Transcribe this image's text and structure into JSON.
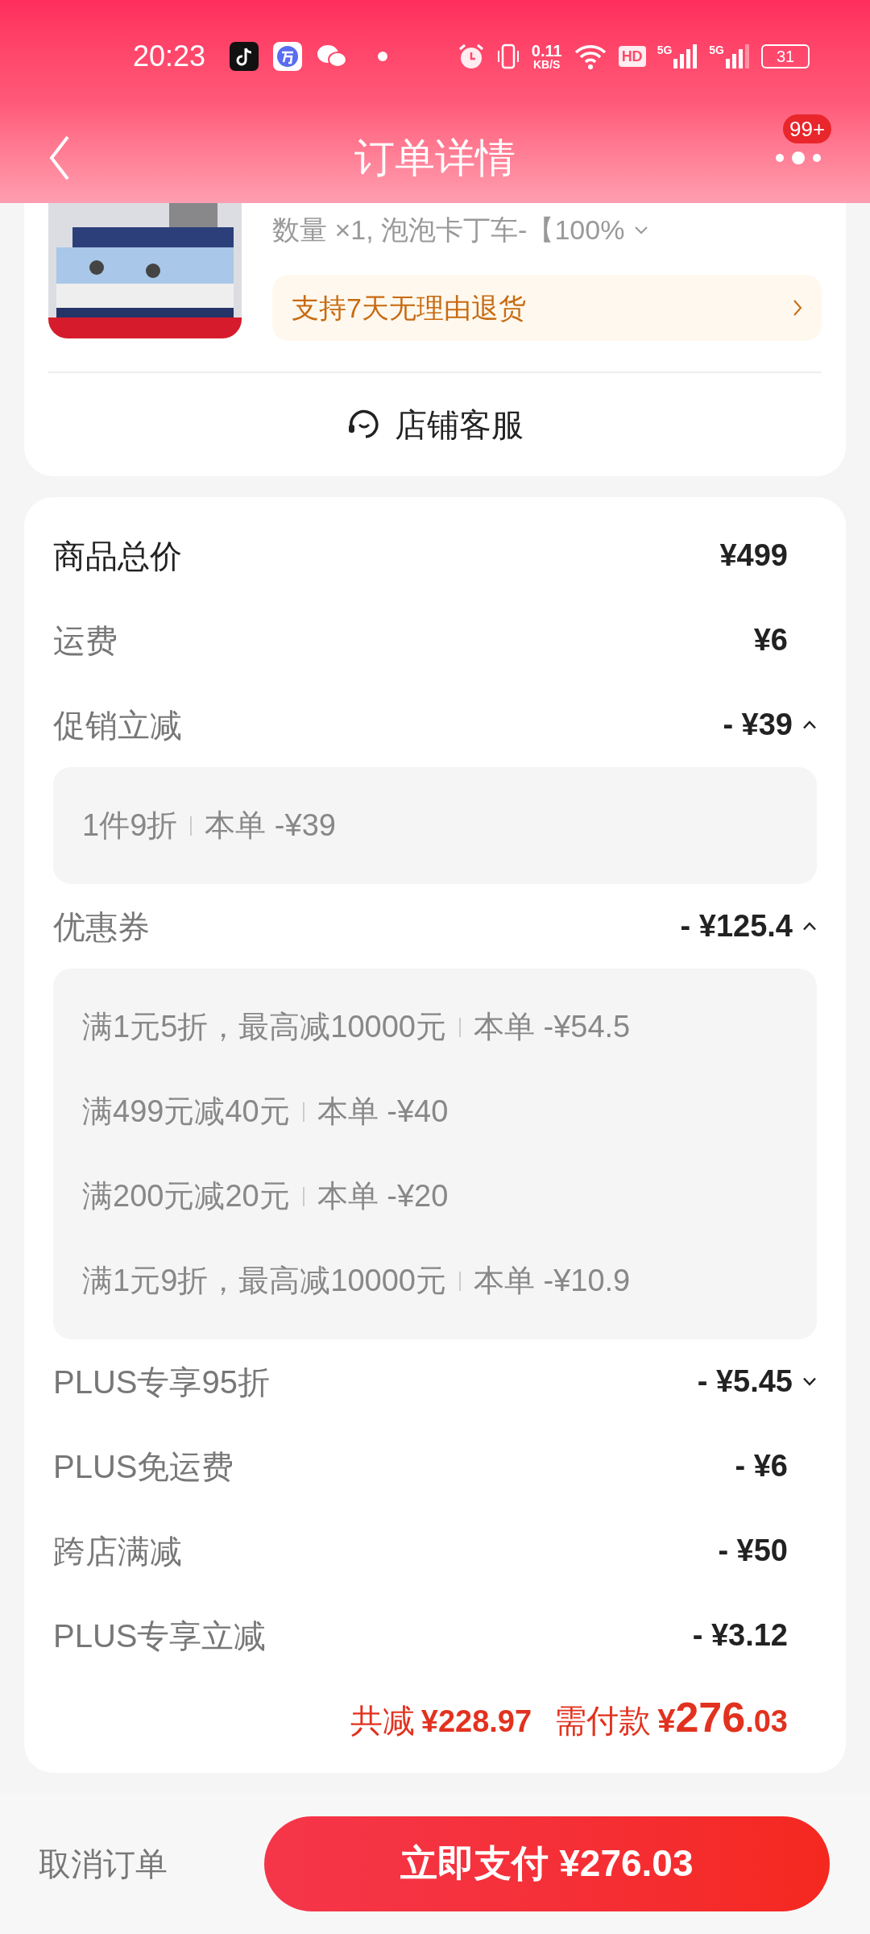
{
  "status_bar": {
    "time": "20:23",
    "net_speed": "0.11",
    "net_unit": "KB/S",
    "hd": "HD",
    "network_1": "5G",
    "network_2": "5G",
    "battery": "31"
  },
  "header": {
    "title": "订单详情",
    "badge": "99+"
  },
  "product": {
    "quantity_spec": "数量 ×1, 泡泡卡丁车-【100%",
    "return_policy": "支持7天无理由退货",
    "customer_service": "店铺客服"
  },
  "price_rows": [
    {
      "kind": "total",
      "label": "商品总价",
      "amount": "¥499"
    },
    {
      "kind": "plain",
      "label": "运费",
      "amount": "¥6"
    },
    {
      "kind": "expandable",
      "label": "促销立减",
      "amount": "- ¥39",
      "expanded": true,
      "details": [
        {
          "desc": "1件9折",
          "amount": "本单 -¥39"
        }
      ]
    },
    {
      "kind": "expandable",
      "label": "优惠券",
      "amount": "- ¥125.4",
      "expanded": true,
      "details": [
        {
          "desc": "满1元5折，最高减10000元",
          "amount": "本单 -¥54.5"
        },
        {
          "desc": "满499元减40元",
          "amount": "本单 -¥40"
        },
        {
          "desc": "满200元减20元",
          "amount": "本单 -¥20"
        },
        {
          "desc": "满1元9折，最高减10000元",
          "amount": "本单 -¥10.9"
        }
      ]
    },
    {
      "kind": "expandable",
      "label": "PLUS专享95折",
      "amount": "- ¥5.45",
      "expanded": false
    },
    {
      "kind": "plain",
      "label": "PLUS免运费",
      "amount": "- ¥6"
    },
    {
      "kind": "plain",
      "label": "跨店满减",
      "amount": "- ¥50"
    },
    {
      "kind": "plain",
      "label": "PLUS专享立减",
      "amount": "- ¥3.12"
    }
  ],
  "totals": {
    "saved_label": "共减",
    "saved": "¥228.97",
    "pay_label": "需付款",
    "pay_currency": "¥",
    "pay_int": "276",
    "pay_dec": ".03"
  },
  "footer": {
    "cancel": "取消订单",
    "pay_button": "立即支付 ¥276.03"
  }
}
